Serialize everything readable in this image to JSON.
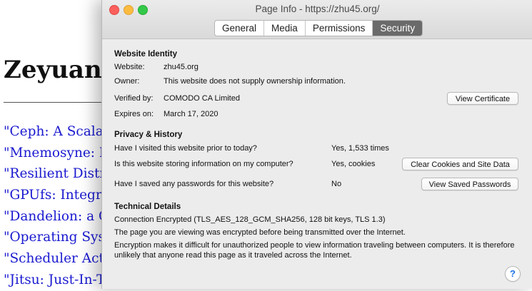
{
  "background_page": {
    "title": "Zeyuan",
    "links": [
      "\"Ceph: A Scalal",
      "\"Mnemosyne: I",
      "\"Resilient Distr",
      "\"GPUfs: Integra",
      "\"Dandelion: a C",
      "\"Operating Sys",
      "\"Scheduler Act",
      "\"Jitsu: Just-In-T"
    ]
  },
  "window": {
    "title": "Page Info - https://zhu45.org/",
    "tabs": [
      {
        "label": "General"
      },
      {
        "label": "Media"
      },
      {
        "label": "Permissions"
      },
      {
        "label": "Security",
        "active": true
      }
    ]
  },
  "identity": {
    "heading": "Website Identity",
    "website_label": "Website:",
    "website_value": "zhu45.org",
    "owner_label": "Owner:",
    "owner_value": "This website does not supply ownership information.",
    "verified_label": "Verified by:",
    "verified_value": "COMODO CA Limited",
    "expires_label": "Expires on:",
    "expires_value": "March 17, 2020",
    "view_certificate": "View Certificate"
  },
  "privacy": {
    "heading": "Privacy & History",
    "visited_q": "Have I visited this website prior to today?",
    "visited_a": "Yes, 1,533 times",
    "storing_q": "Is this website storing information on my computer?",
    "storing_a": "Yes, cookies",
    "clear_button": "Clear Cookies and Site Data",
    "passwords_q": "Have I saved any passwords for this website?",
    "passwords_a": "No",
    "passwords_button": "View Saved Passwords"
  },
  "technical": {
    "heading": "Technical Details",
    "connection": "Connection Encrypted (TLS_AES_128_GCM_SHA256, 128 bit keys, TLS 1.3)",
    "line1": "The page you are viewing was encrypted before being transmitted over the Internet.",
    "line2": "Encryption makes it difficult for unauthorized people to view information traveling between computers. It is therefore unlikely that anyone read this page as it traveled across the Internet."
  },
  "help_label": "?",
  "colors": {
    "close": "#fc605c",
    "minimize": "#fdbc40",
    "maximize": "#34c84a",
    "link": "#1a1ad0",
    "active_tab": "#6a6a6a",
    "help_mark": "#1a73e8"
  }
}
